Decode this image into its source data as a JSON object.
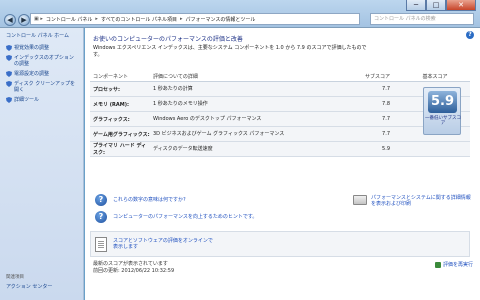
{
  "address_bar": {
    "crumbs": [
      "コントロール パネル",
      "すべてのコントロール パネル項目",
      "パフォーマンスの情報とツール"
    ],
    "search_placeholder": "コントロール パネルの検索"
  },
  "window_buttons": [
    "─",
    "□",
    "✕"
  ],
  "sidebar": {
    "home": "コントロール パネル ホーム",
    "items": [
      {
        "label": "視覚効果の調整",
        "icon": "shield-icon"
      },
      {
        "label": "インデックスのオプションの調整",
        "icon": "shield-icon"
      },
      {
        "label": "電源設定の調整",
        "icon": "shield-icon"
      },
      {
        "label": "ディスク クリーンアップを開く",
        "icon": "shield-icon"
      },
      {
        "label": "詳細ツール",
        "icon": "shield-icon"
      }
    ],
    "see_also": "関連項目",
    "action_center": "アクション センター"
  },
  "main": {
    "heading": "お使いのコンピューターのパフォーマンスの評価と改善",
    "description": "Windows エクスペリエンス インデックスは、主要なシステム コンポーネントを 1.0 から 7.9 のスコアで評価したものです。",
    "columns": {
      "component": "コンポーネント",
      "rated": "評価についての詳細",
      "subscore": "サブスコア",
      "base": "基本スコア"
    },
    "rows": [
      {
        "component": "プロセッサ:",
        "detail": "1 秒あたりの計算",
        "subscore": "7.7"
      },
      {
        "component": "メモリ (RAM):",
        "detail": "1 秒あたりのメモリ操作",
        "subscore": "7.8"
      },
      {
        "component": "グラフィックス:",
        "detail": "Windows Aero のデスクトップ パフォーマンス",
        "subscore": "7.7"
      },
      {
        "component": "ゲーム用グラフィックス:",
        "detail": "3D ビジネスおよびゲーム グラフィックス パフォーマンス",
        "subscore": "7.7"
      },
      {
        "component": "プライマリ ハード ディスク:",
        "detail": "ディスクのデータ転送速度",
        "subscore": "5.9"
      }
    ],
    "base_score": "5.9",
    "base_score_caption": "一番低いサブスコア",
    "links": [
      "これらの数字の意味は何ですか?",
      "コンピューターのパフォーマンスを向上するためのヒントです。"
    ],
    "print_link": "パフォーマンスとシステムに関する詳細情報を表示および印刷",
    "rating_link": "スコアとソフトウェアの評価をオンラインで表示します",
    "status_line1": "最新のスコアが表示されています",
    "status_line2": "前回の更新: 2012/06/22 10:32:59",
    "rerun": "評価を再実行"
  }
}
